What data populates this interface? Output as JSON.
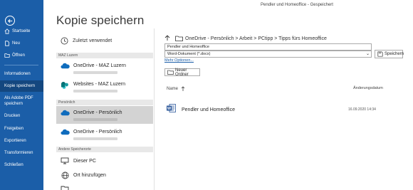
{
  "window": {
    "title": "Pendler und Homeoffice  -  Gespeichert"
  },
  "sidebar": {
    "items": [
      {
        "label": "Startseite"
      },
      {
        "label": "Neu"
      },
      {
        "label": "Öffnen"
      },
      {
        "label": "Informationen"
      },
      {
        "label": "Kopie speichern"
      },
      {
        "label_line1": "Als Adobe PDF",
        "label_line2": "speichern"
      },
      {
        "label": "Drucken"
      },
      {
        "label": "Freigeben"
      },
      {
        "label": "Exportieren"
      },
      {
        "label": "Transformieren"
      },
      {
        "label": "Schließen"
      }
    ]
  },
  "page": {
    "title": "Kopie speichern"
  },
  "locations": {
    "recent_label": "Zuletzt verwendet",
    "groups": [
      {
        "header": "MAZ Luzern"
      },
      {
        "header": "Persönlich"
      },
      {
        "header": "Andere Speicherorte"
      }
    ],
    "items": [
      {
        "name": "OneDrive - MAZ Luzern"
      },
      {
        "name": "Websites - MAZ Luzern"
      },
      {
        "name": "OneDrive - Persönlich"
      },
      {
        "name": "OneDrive - Persönlich"
      },
      {
        "name": "Dieser PC"
      },
      {
        "name": "Ort hinzufügen"
      }
    ]
  },
  "save_panel": {
    "breadcrumb": "OneDrive - Persönlich > Arbeit > PCtipp > Tipps fürs Homeoffice",
    "filename": "Pendler und Homeoffice",
    "filetype": "Word-Dokument (*.docx)",
    "more_options": "Mehr Optionen...",
    "save_label": "Speichern",
    "new_folder_label": "Neuer Ordner",
    "columns": {
      "name": "Name",
      "date": "Änderungsdatum"
    },
    "files": [
      {
        "name": "Pendler und Homeoffice",
        "date": "16.09.2020 14:34"
      }
    ]
  },
  "colors": {
    "sidebar": "#1b5ea8",
    "selected_sidebar": "#14477f",
    "onedrive": "#0f6cbd"
  }
}
